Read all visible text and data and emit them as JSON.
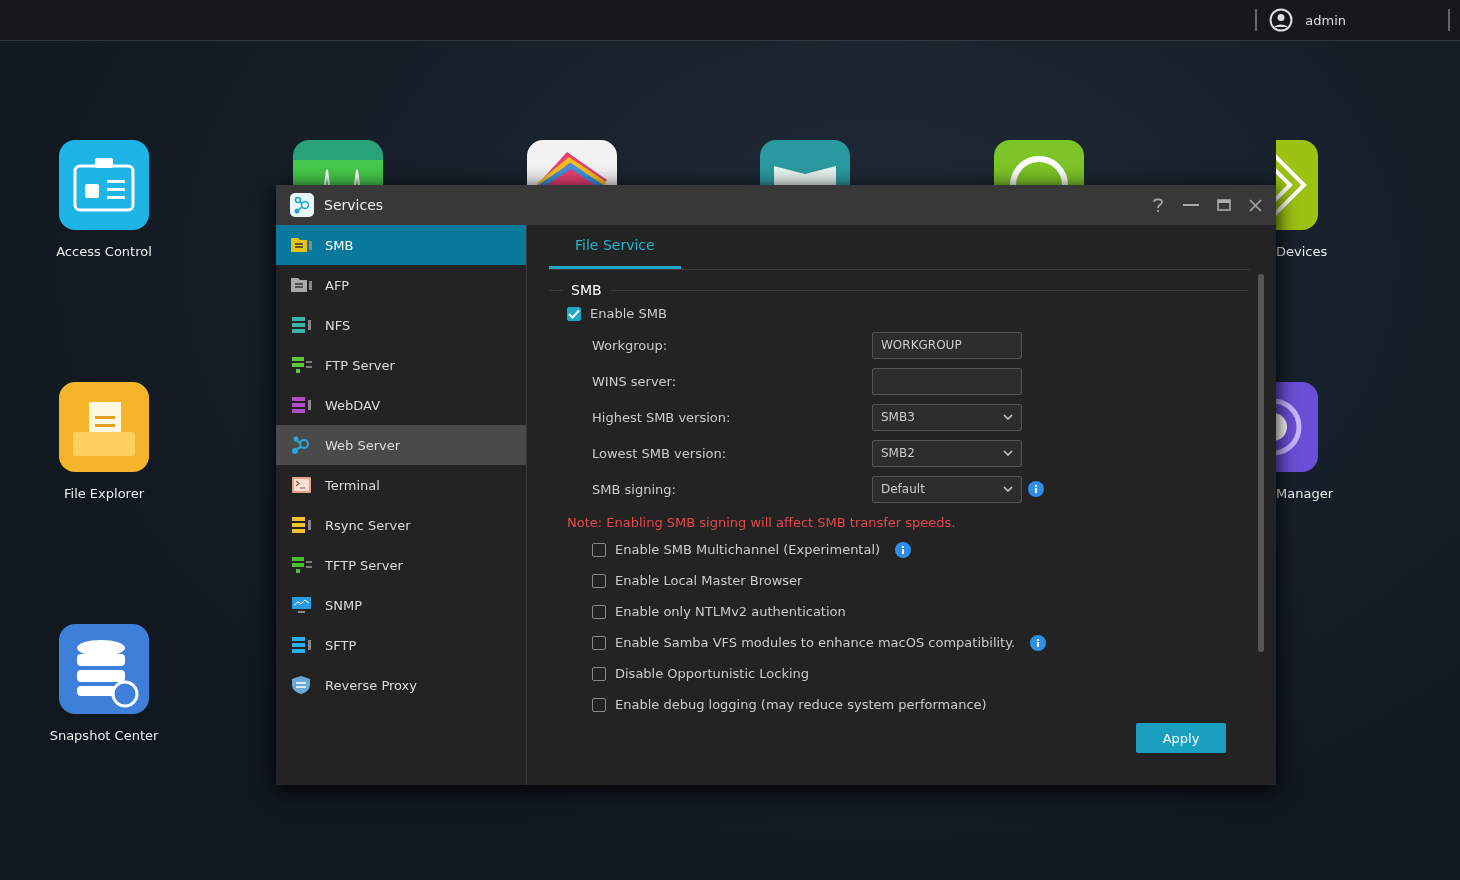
{
  "top_bar": {
    "user": "admin"
  },
  "desktop_icons": [
    {
      "kind": "badge",
      "label": "Access Control",
      "color": "#1fb4e6"
    },
    {
      "kind": "folder",
      "label": "File Explorer",
      "color": "#f5b52a"
    },
    {
      "kind": "database",
      "label": "Snapshot Center",
      "color": "#3d7fd9"
    },
    {
      "kind": "monitor",
      "color": "#2aa37a"
    },
    {
      "kind": "layers",
      "color": "#f2f2f2"
    },
    {
      "kind": "map",
      "color": "#2a9aa0"
    },
    {
      "kind": "ring",
      "color": "#7cc428"
    },
    {
      "kind": "diamond",
      "label": "Devices",
      "color": "#9cc214"
    },
    {
      "kind": "disc",
      "label": "Manager",
      "color": "#6a4fd8"
    }
  ],
  "window": {
    "title": "Services",
    "sidebar": [
      {
        "label": "SMB",
        "kind": "folder",
        "color": "#e6c21a",
        "selected": true,
        "hovered": false
      },
      {
        "label": "AFP",
        "kind": "folder",
        "color": "#a8a8a8",
        "selected": false,
        "hovered": false
      },
      {
        "label": "NFS",
        "kind": "server",
        "color": "#3bb5a5",
        "selected": false,
        "hovered": false
      },
      {
        "label": "FTP Server",
        "kind": "transfer",
        "color": "#5cc83a",
        "selected": false,
        "hovered": false
      },
      {
        "label": "WebDAV",
        "kind": "server",
        "color": "#b04fc8",
        "selected": false,
        "hovered": false
      },
      {
        "label": "Web Server",
        "kind": "nodes",
        "color": "#2aa8e0",
        "selected": false,
        "hovered": true
      },
      {
        "label": "Terminal",
        "kind": "terminal",
        "color": "#e8a080",
        "selected": false,
        "hovered": false
      },
      {
        "label": "Rsync Server",
        "kind": "server",
        "color": "#f0c030",
        "selected": false,
        "hovered": false
      },
      {
        "label": "TFTP Server",
        "kind": "transfer",
        "color": "#46c030",
        "selected": false,
        "hovered": false
      },
      {
        "label": "SNMP",
        "kind": "monitor",
        "color": "#2a9ae0",
        "selected": false,
        "hovered": false
      },
      {
        "label": "SFTP",
        "kind": "server",
        "color": "#2ab0f0",
        "selected": false,
        "hovered": false
      },
      {
        "label": "Reverse Proxy",
        "kind": "shield",
        "color": "#6aa8d8",
        "selected": false,
        "hovered": false
      }
    ],
    "tabs": [
      {
        "label": "File Service",
        "selected": true
      }
    ],
    "section": "SMB",
    "enable": {
      "label": "Enable SMB",
      "checked": true
    },
    "fields": [
      {
        "label": "Workgroup:",
        "kind": "text",
        "value": "WORKGROUP"
      },
      {
        "label": "WINS server:",
        "kind": "text"
      },
      {
        "label": "Highest SMB version:",
        "kind": "select",
        "value": "SMB3"
      },
      {
        "label": "Lowest SMB version:",
        "kind": "select",
        "value": "SMB2"
      },
      {
        "label": "SMB signing:",
        "kind": "select",
        "value": "Default",
        "info": true
      }
    ],
    "note": "Note: Enabling SMB signing will affect SMB transfer speeds.",
    "options": [
      {
        "label": "Enable SMB Multichannel (Experimental)",
        "checked": false,
        "info": true
      },
      {
        "label": "Enable Local Master Browser",
        "checked": false
      },
      {
        "label": "Enable only NTLMv2 authentication",
        "checked": false
      },
      {
        "label": "Enable Samba VFS modules to enhance macOS compatibility.",
        "checked": false,
        "info": true
      },
      {
        "label": "Disable Opportunistic Locking",
        "checked": false
      },
      {
        "label": "Enable debug logging (may reduce system performance)",
        "checked": false
      }
    ],
    "apply": "Apply"
  }
}
